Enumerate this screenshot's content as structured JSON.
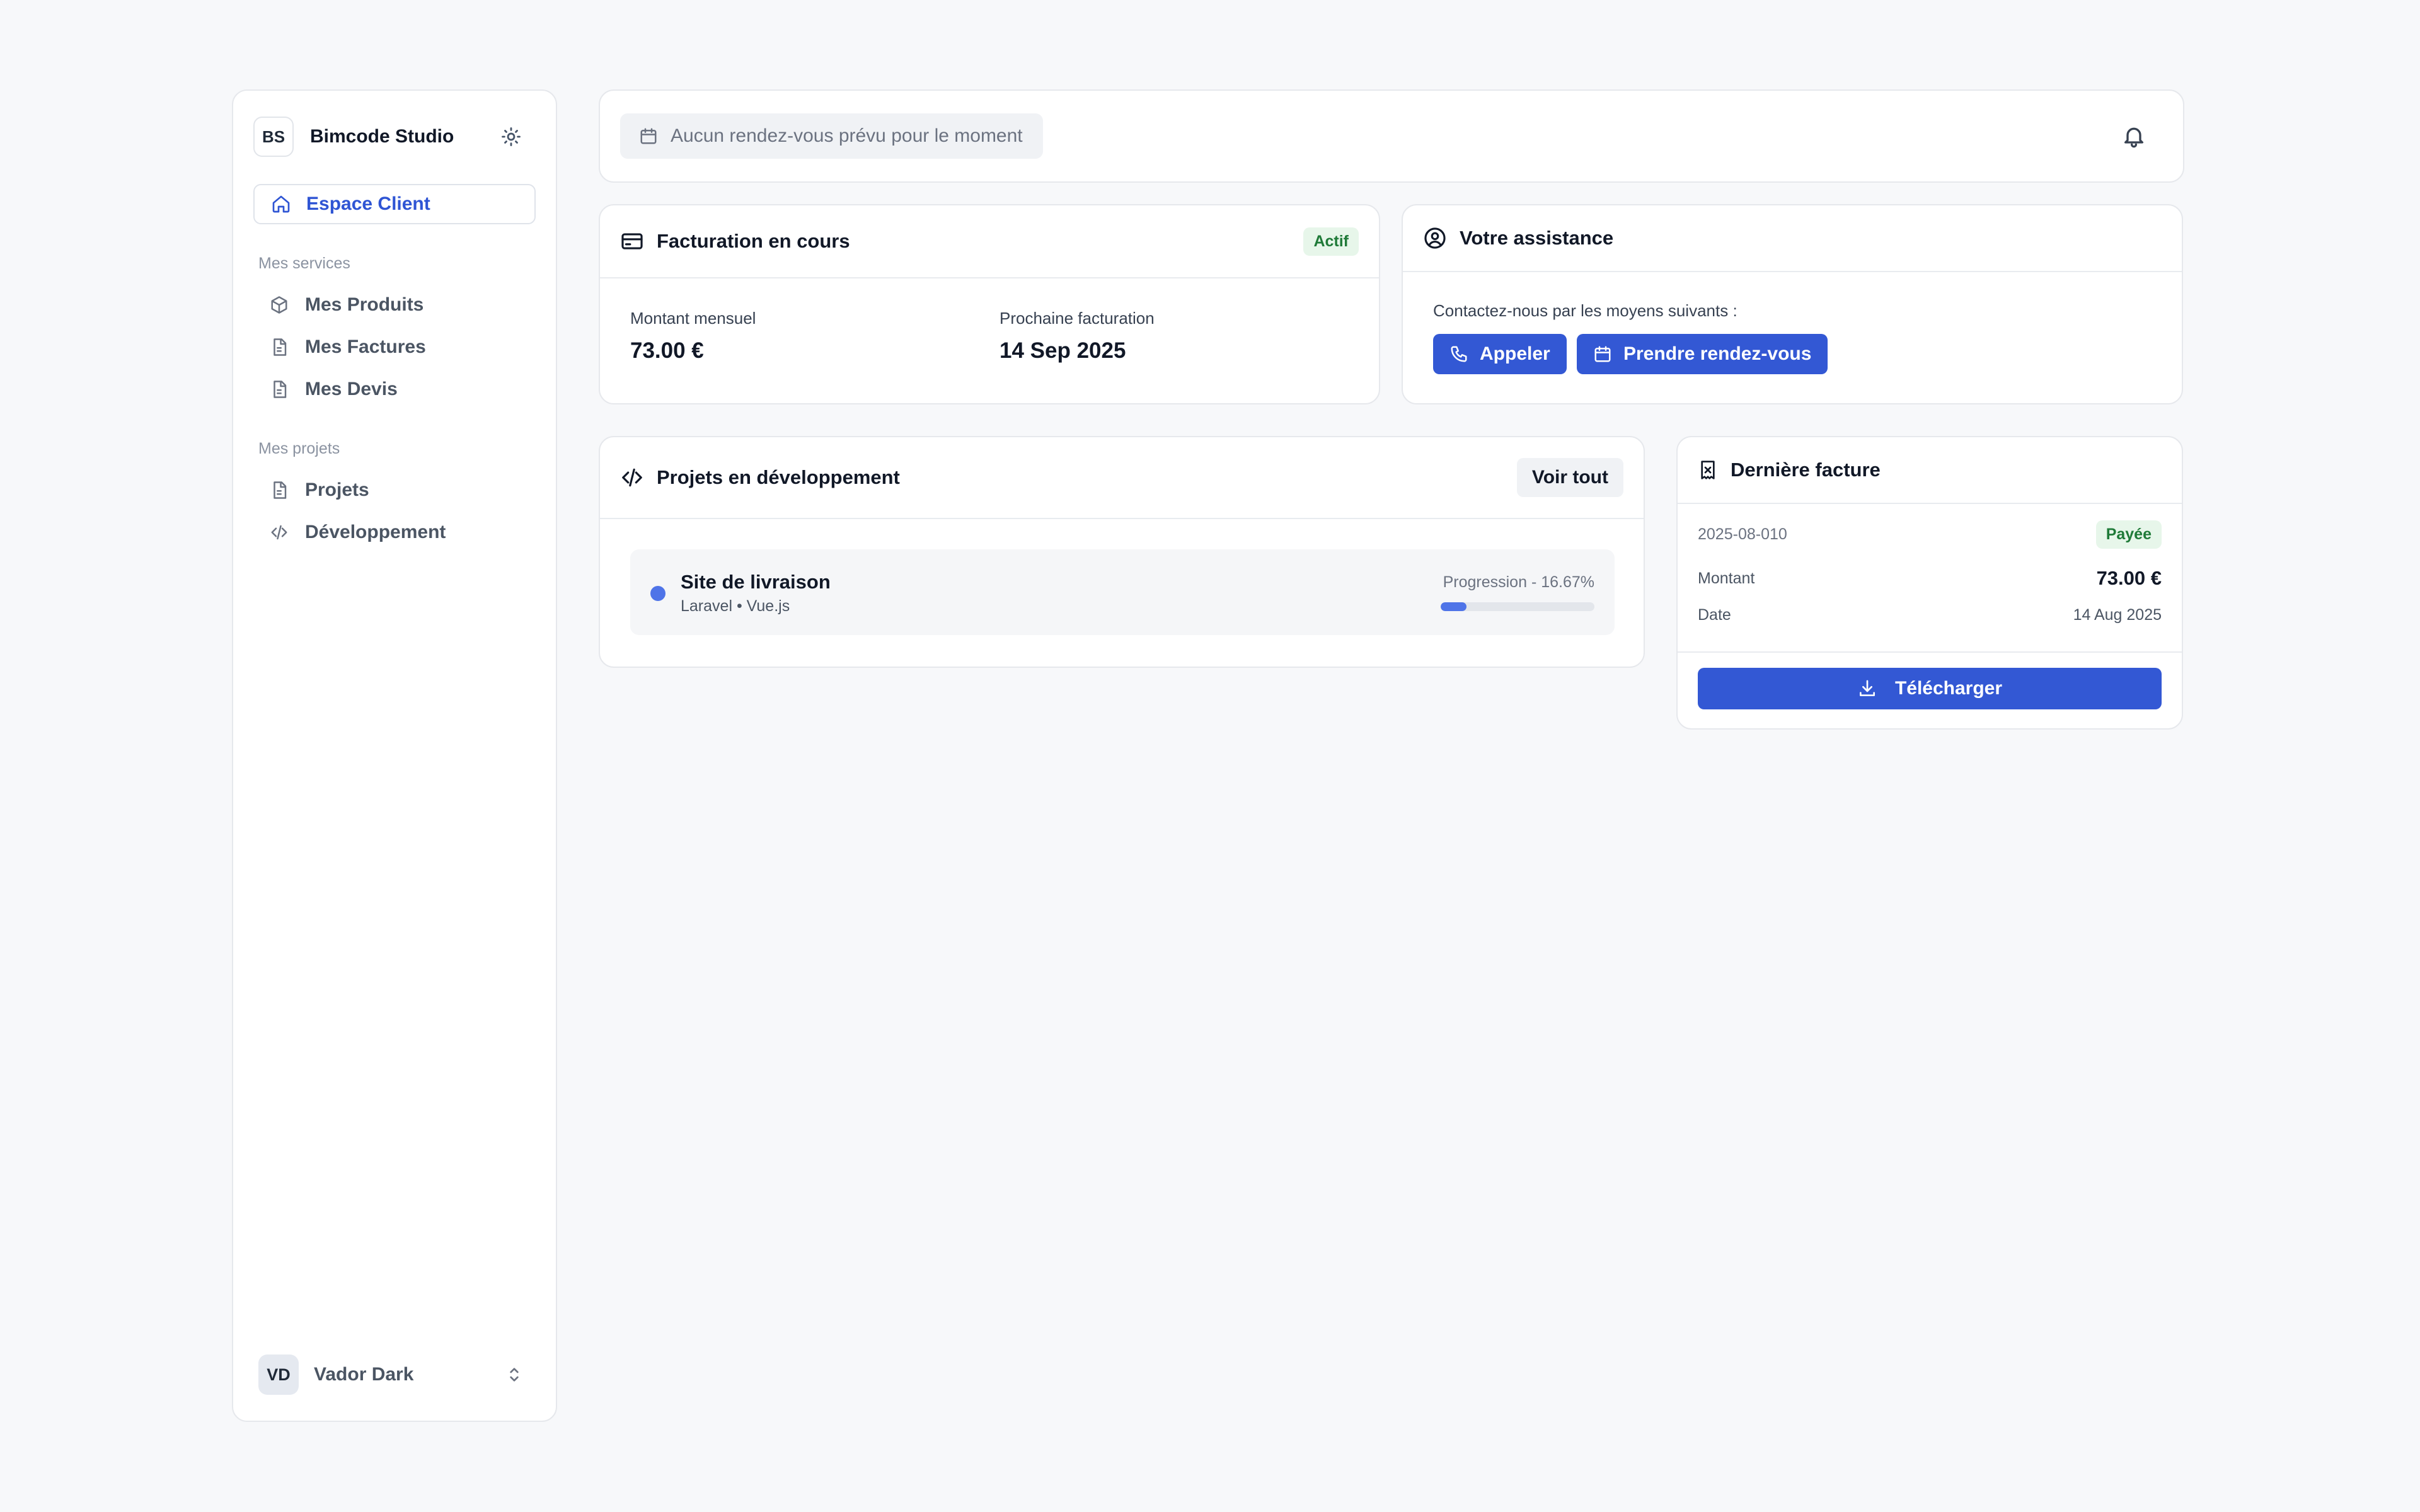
{
  "sidebar": {
    "brand_initials": "BS",
    "brand_name": "Bimcode Studio",
    "active_item": "Espace Client",
    "sections": [
      {
        "label": "Mes services",
        "items": [
          "Mes Produits",
          "Mes Factures",
          "Mes Devis"
        ]
      },
      {
        "label": "Mes projets",
        "items": [
          "Projets",
          "Développement"
        ]
      }
    ],
    "user": {
      "initials": "VD",
      "name": "Vador Dark"
    }
  },
  "topbar": {
    "appointment_text": "Aucun rendez-vous prévu pour le moment"
  },
  "billing": {
    "title": "Facturation en cours",
    "status": "Actif",
    "monthly_label": "Montant mensuel",
    "monthly_value": "73.00 €",
    "next_label": "Prochaine facturation",
    "next_value": "14 Sep 2025"
  },
  "support": {
    "title": "Votre assistance",
    "text": "Contactez-nous par les moyens suivants :",
    "call_label": "Appeler",
    "appointment_label": "Prendre rendez-vous"
  },
  "projects": {
    "title": "Projets en développement",
    "view_all": "Voir tout",
    "items": [
      {
        "name": "Site de livraison",
        "tech": "Laravel • Vue.js",
        "progress_label": "Progression - 16.67%",
        "progress": 16.67
      }
    ]
  },
  "invoice": {
    "title": "Dernière facture",
    "number": "2025-08-010",
    "status": "Payée",
    "amount_label": "Montant",
    "amount_value": "73.00 €",
    "date_label": "Date",
    "date_value": "14 Aug 2025",
    "download_label": "Télécharger"
  },
  "colors": {
    "accent": "#3358d4",
    "success_bg": "#e7f6ea",
    "success_text": "#1f7a38",
    "background": "#f7f8fa"
  }
}
